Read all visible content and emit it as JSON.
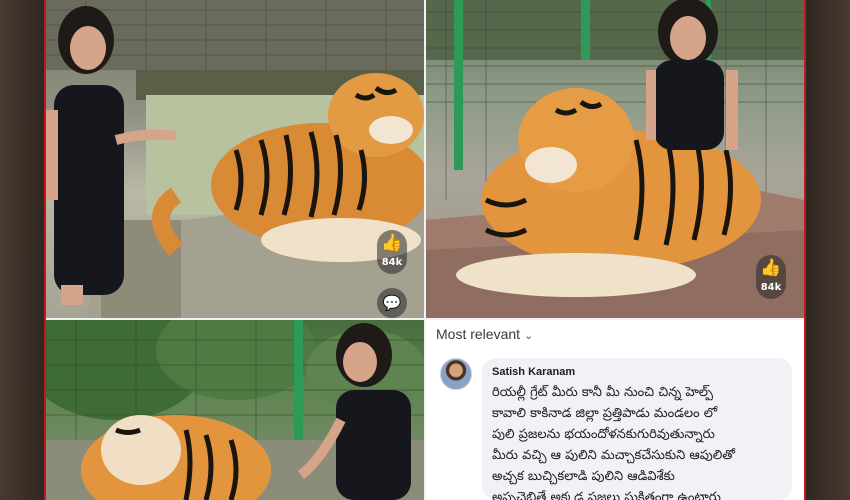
{
  "photos": {
    "top_left": {
      "likes": "84k"
    },
    "top_right": {
      "likes": "84k"
    }
  },
  "comments": {
    "sort_label": "Most relevant",
    "author": "Satish Karanam",
    "text_lines": [
      "రియల్లీ గ్రేట్ మీరు కానీ మీ నుంచి చిన్న హెల్ప్",
      "కావాలి కాకినాడ జిల్లా ప్రత్తిపాడు మండలం లో",
      "పులి ప్రజలను భయందోళనకుగురివుతున్నారు",
      "మీరు వచ్చి ఆ పులిని మచ్చాకచేసుకుని ఆపులితో",
      "అచ్చక బుచ్చికలాడి పులిని ఆడివిశేకు",
      "అప్పచెబితే అక్కడ ప్రజలు సుక్షితంగా ఉంటారు"
    ]
  },
  "colors": {
    "frame_red": "#c4161c",
    "comment_bg": "#f0f2f5"
  }
}
